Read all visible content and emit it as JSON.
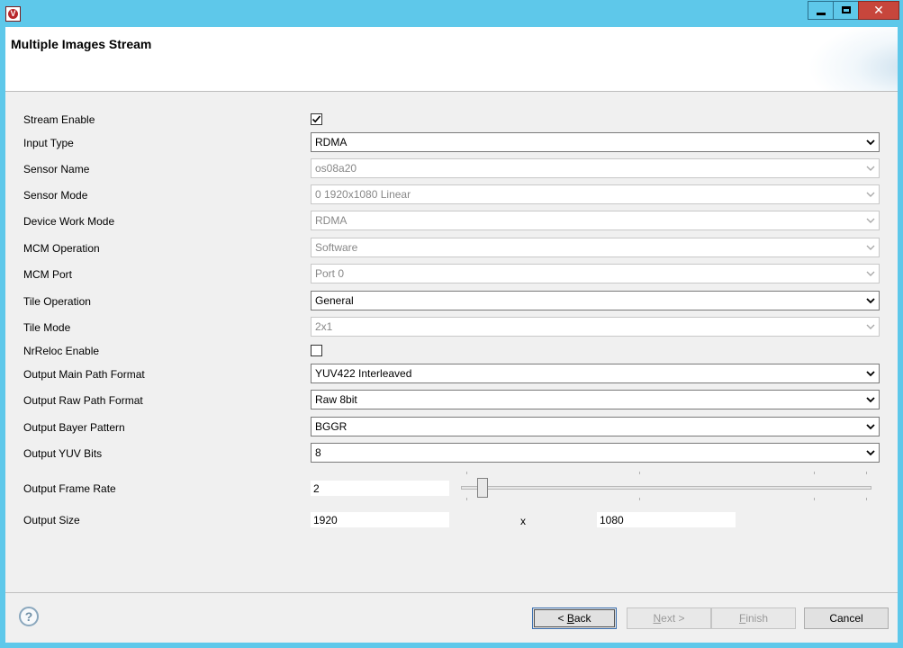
{
  "window": {
    "title_controls": {
      "minimize": "minimize",
      "maximize": "maximize",
      "close": "close"
    }
  },
  "header": {
    "title": "Multiple Images Stream"
  },
  "form": {
    "stream_enable": {
      "label": "Stream Enable",
      "checked": true
    },
    "input_type": {
      "label": "Input Type",
      "value": "RDMA",
      "enabled": true
    },
    "sensor_name": {
      "label": "Sensor Name",
      "value": "os08a20",
      "enabled": false
    },
    "sensor_mode": {
      "label": "Sensor Mode",
      "value": "0 1920x1080 Linear",
      "enabled": false
    },
    "device_work_mode": {
      "label": "Device Work Mode",
      "value": "RDMA",
      "enabled": false
    },
    "mcm_operation": {
      "label": "MCM Operation",
      "value": "Software",
      "enabled": false
    },
    "mcm_port": {
      "label": "MCM Port",
      "value": "Port 0",
      "enabled": false
    },
    "tile_operation": {
      "label": "Tile Operation",
      "value": "General",
      "enabled": true
    },
    "tile_mode": {
      "label": "Tile Mode",
      "value": "2x1",
      "enabled": false
    },
    "nrreloc_enable": {
      "label": "NrReloc Enable",
      "checked": false
    },
    "output_main_path_format": {
      "label": "Output Main Path Format",
      "value": "YUV422 Interleaved",
      "enabled": true
    },
    "output_raw_path_format": {
      "label": "Output Raw Path Format",
      "value": "Raw 8bit",
      "enabled": true
    },
    "output_bayer_pattern": {
      "label": "Output Bayer Pattern",
      "value": "BGGR",
      "enabled": true
    },
    "output_yuv_bits": {
      "label": "Output YUV Bits",
      "value": "8",
      "enabled": true
    },
    "output_frame_rate": {
      "label": "Output Frame Rate",
      "value": "2"
    },
    "output_size": {
      "label": "Output Size",
      "width": "1920",
      "separator": "x",
      "height": "1080"
    }
  },
  "footer": {
    "help_glyph": "?",
    "back": {
      "prefix": "< ",
      "mnemonic": "B",
      "rest": "ack"
    },
    "next": {
      "mnemonic": "N",
      "rest": "ext >"
    },
    "finish": {
      "mnemonic": "F",
      "rest": "inish"
    },
    "cancel": "Cancel"
  }
}
